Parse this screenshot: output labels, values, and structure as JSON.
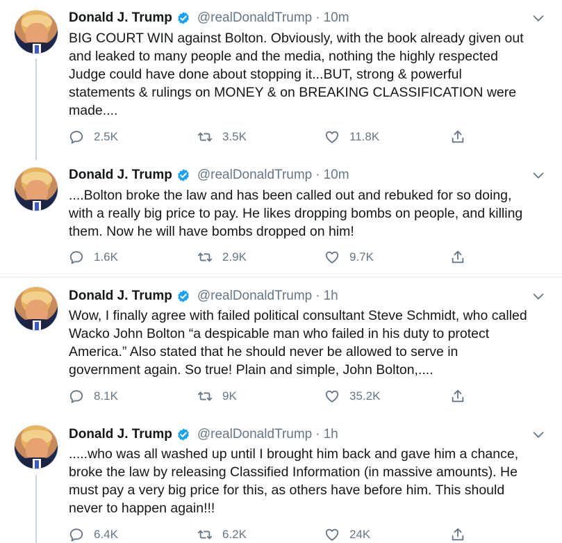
{
  "colors": {
    "accent": "#1da1f2",
    "text": "#14171a",
    "muted": "#657786",
    "divider": "#e6ecf0"
  },
  "tweets": [
    {
      "name": "Donald J. Trump",
      "handle": "@realDonaldTrump",
      "separator": "·",
      "time": "10m",
      "text": "BIG COURT WIN against Bolton. Obviously, with the book already given out\nand leaked to many people and the media, nothing the highly respected\nJudge could have done about stopping it...BUT, strong & powerful\nstatements & rulings on MONEY & on BREAKING CLASSIFICATION were\nmade....",
      "replies": "2.5K",
      "retweets": "3.5K",
      "likes": "11.8K"
    },
    {
      "name": "Donald J. Trump",
      "handle": "@realDonaldTrump",
      "separator": "·",
      "time": "10m",
      "text": "....Bolton broke the law and has been called out and rebuked for so doing,\nwith a really big price to pay. He likes dropping bombs on people, and killing\nthem. Now he will have bombs dropped on him!",
      "replies": "1.6K",
      "retweets": "2.9K",
      "likes": "9.7K"
    },
    {
      "name": "Donald J. Trump",
      "handle": "@realDonaldTrump",
      "separator": "·",
      "time": "1h",
      "text": "Wow, I finally agree with failed political consultant Steve Schmidt, who called\nWacko John Bolton “a despicable man who failed in his duty to protect\nAmerica.” Also stated that he should never be allowed to serve in\ngovernment again. So true! Plain and simple, John Bolton,....",
      "replies": "8.1K",
      "retweets": "9K",
      "likes": "35.2K"
    },
    {
      "name": "Donald J. Trump",
      "handle": "@realDonaldTrump",
      "separator": "·",
      "time": "1h",
      "text": ".....who was all washed up until I brought him back and gave him a chance,\nbroke the law by releasing Classified Information (in massive amounts). He\nmust pay a very big price for this, as others have before him. This should\nnever to happen again!!!",
      "replies": "6.4K",
      "retweets": "6.2K",
      "likes": "24K"
    }
  ]
}
